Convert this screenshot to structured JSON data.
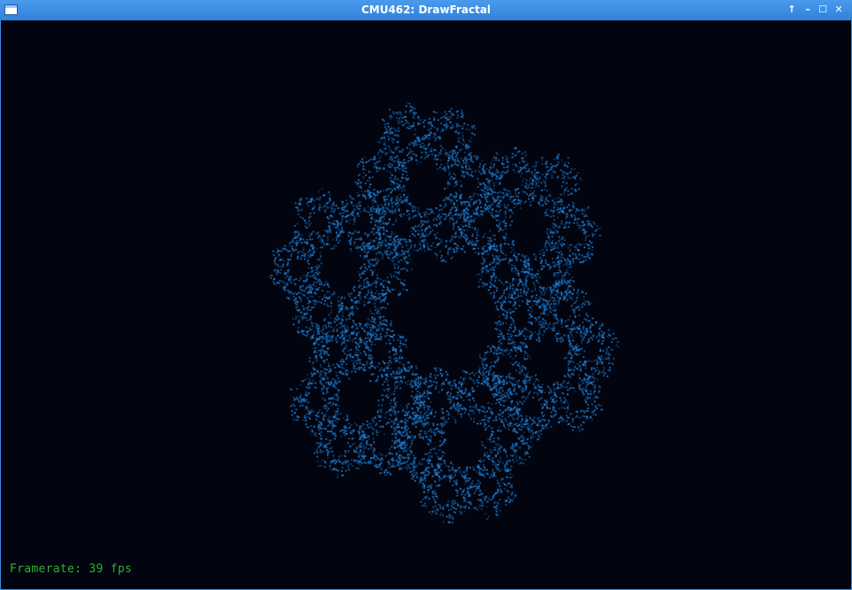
{
  "window": {
    "title": "CMU462: DrawFractal",
    "controls": {
      "up_icon": "↑",
      "minimize_icon": "–",
      "maximize_icon": "☐",
      "close_icon": "✕"
    }
  },
  "canvas": {
    "background": "#02040f",
    "fractal_color": "#1e7fd6",
    "framerate_label": "Framerate: 39 fps"
  }
}
